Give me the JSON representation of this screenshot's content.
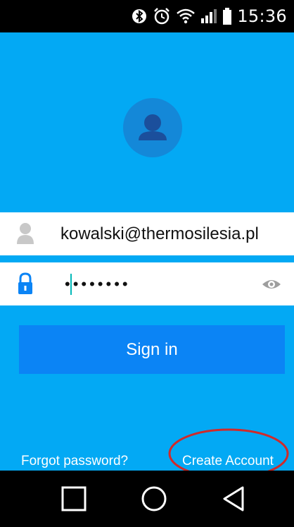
{
  "status_bar": {
    "time": "15:36",
    "icons": [
      "bluetooth-icon",
      "alarm-icon",
      "wifi-icon",
      "signal-icon",
      "battery-icon"
    ]
  },
  "login": {
    "avatar_icon": "user-avatar-icon",
    "email_value": "kowalski@thermosilesia.pl",
    "password_value": "••••••••",
    "sign_in_label": "Sign in",
    "forgot_label": "Forgot password?",
    "create_label": "Create Account"
  },
  "annotation": {
    "color": "#d12a2a",
    "target": "create-account-link"
  },
  "nav_bar": {
    "buttons": [
      "recents-icon",
      "home-icon",
      "back-icon"
    ]
  },
  "colors": {
    "background": "#03a9f4",
    "button": "#0b84f5",
    "avatar_circle": "#1488d8",
    "field_icon_gray": "#c8c8c8",
    "lock_icon": "#0b84f5"
  }
}
